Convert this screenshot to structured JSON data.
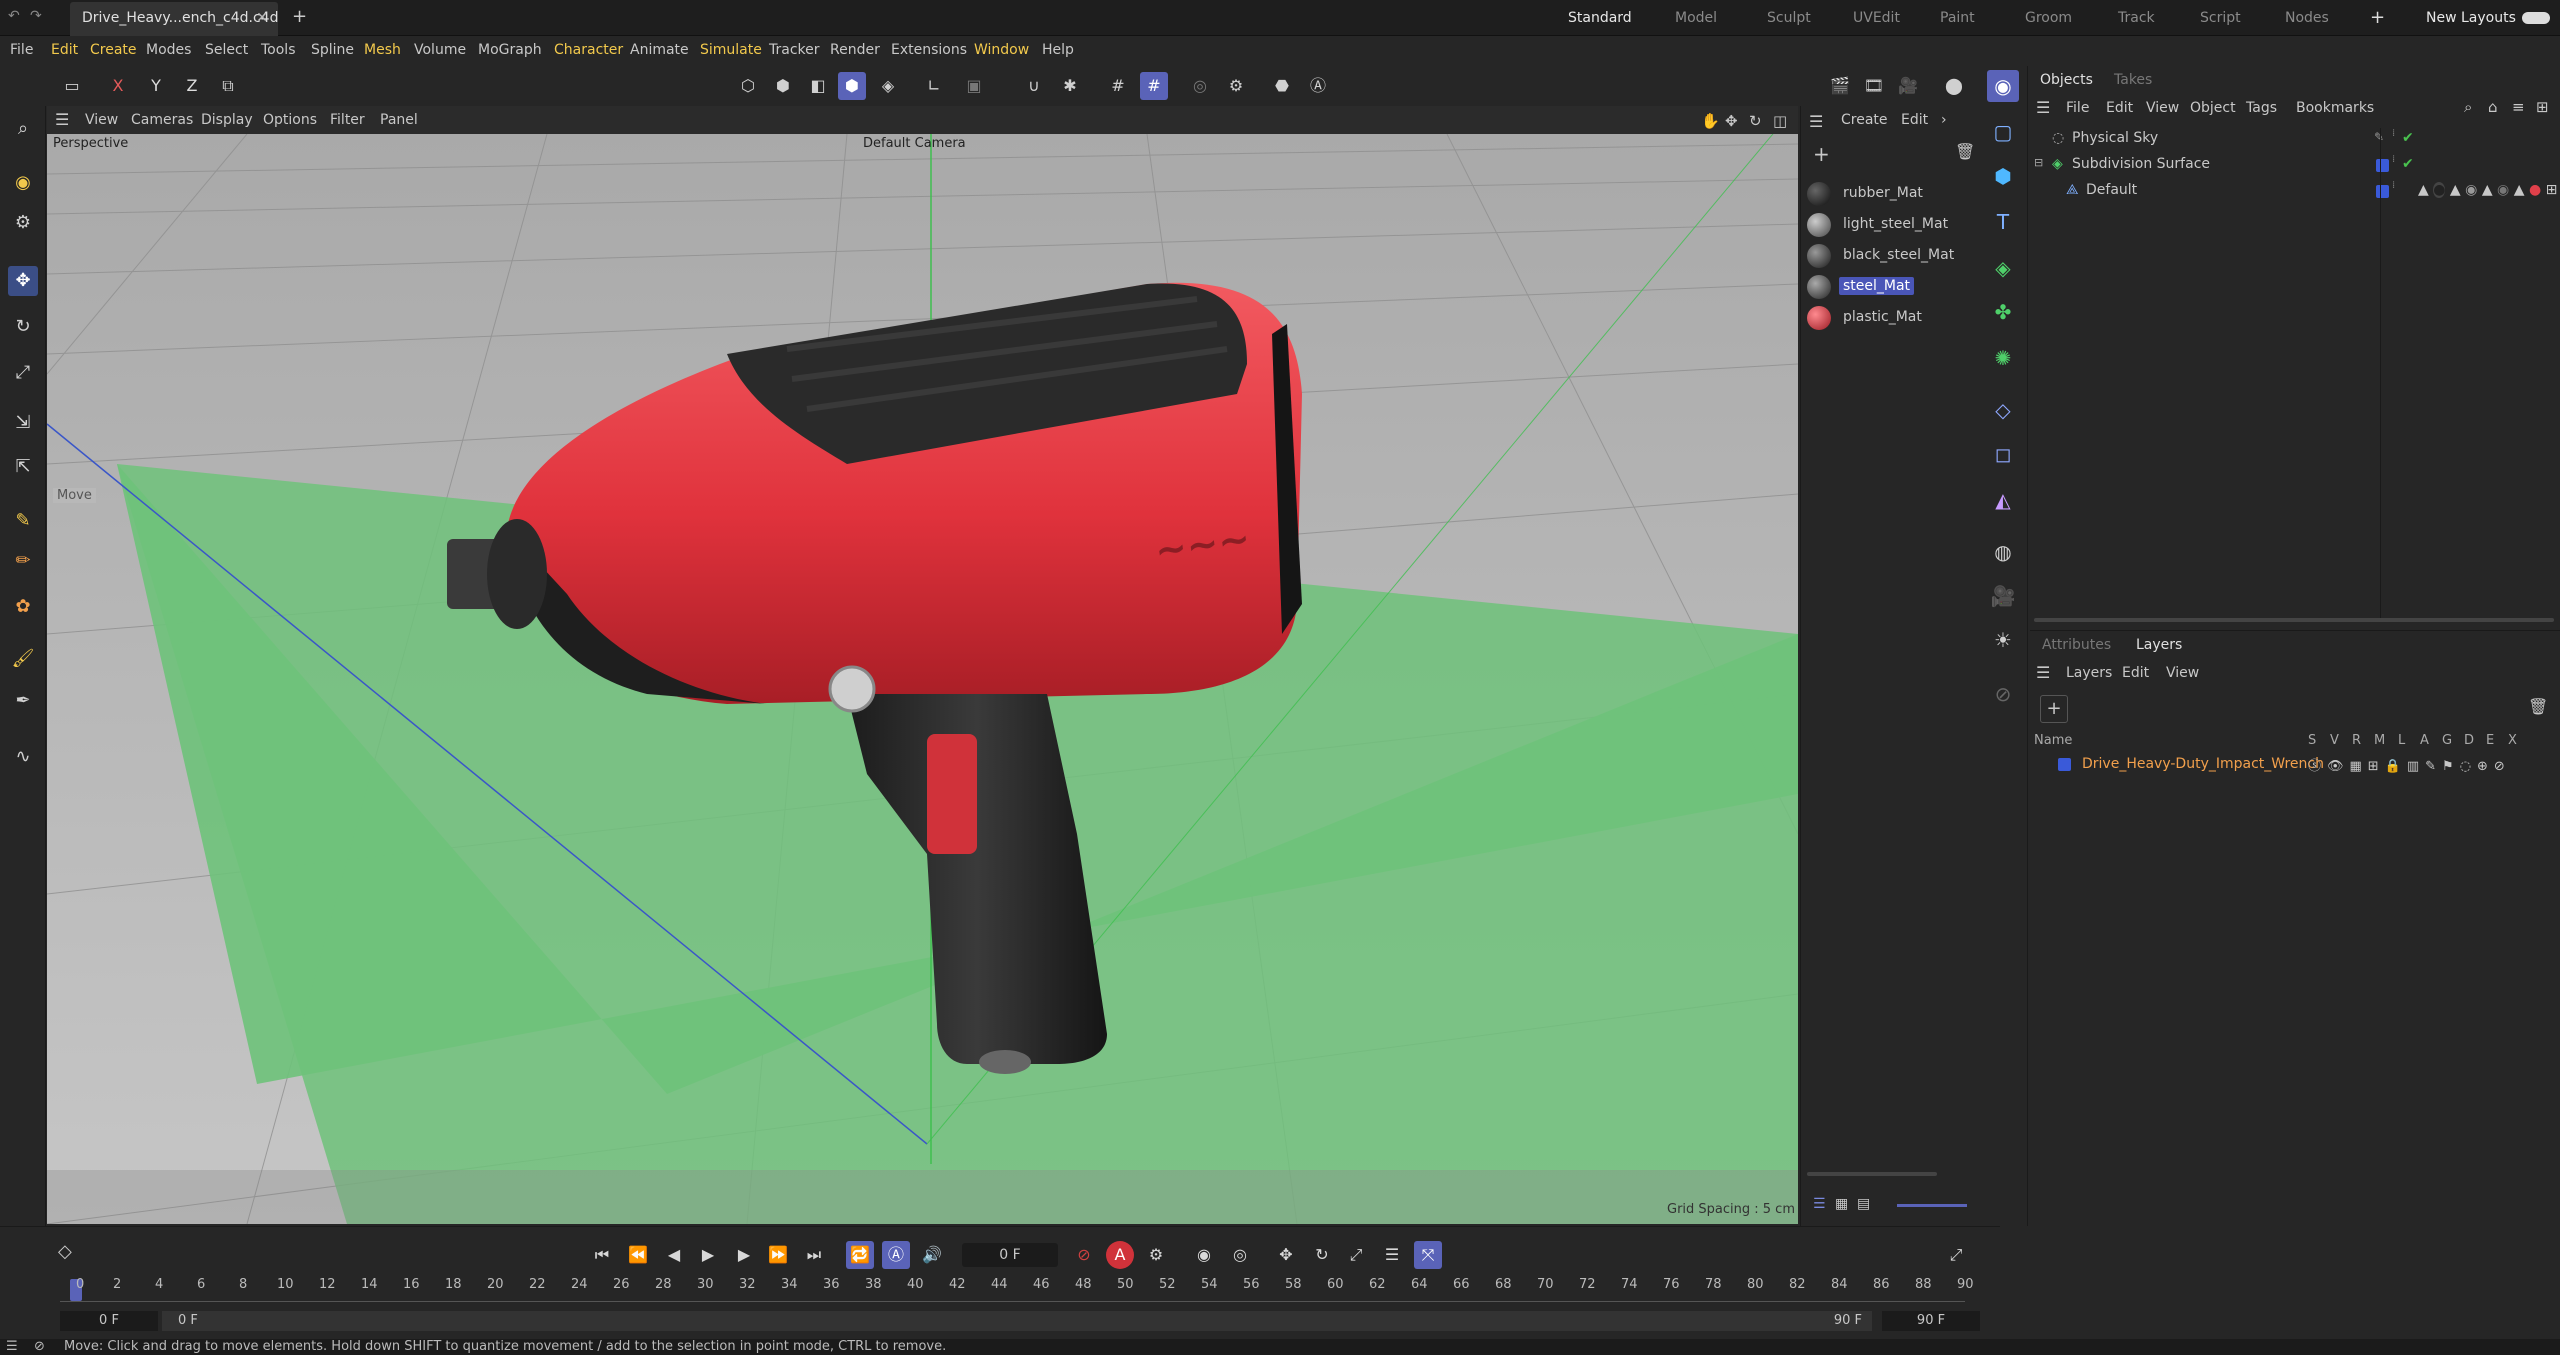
{
  "title_bar": {
    "document_tab": "Drive_Heavy...ench_c4d.c4d",
    "layouts": [
      "Standard",
      "Model",
      "Sculpt",
      "UVEdit",
      "Paint",
      "Groom",
      "Track",
      "Script",
      "Nodes"
    ],
    "new_layouts": "New Layouts"
  },
  "menu": [
    "File",
    "Edit",
    "Create",
    "Modes",
    "Select",
    "Tools",
    "Spline",
    "Mesh",
    "Volume",
    "MoGraph",
    "Character",
    "Animate",
    "Simulate",
    "Tracker",
    "Render",
    "Extensions",
    "Window",
    "Help"
  ],
  "axis_toolbar": {
    "x": "X",
    "y": "Y",
    "z": "Z"
  },
  "viewport": {
    "menu": [
      "View",
      "Cameras",
      "Display",
      "Options",
      "Filter",
      "Panel"
    ],
    "projection": "Perspective",
    "camera": "Default Camera",
    "tool_hint": "Move",
    "grid_spacing": "Grid Spacing : 5 cm"
  },
  "material_manager": {
    "menu": [
      "Create",
      "Edit"
    ],
    "materials": [
      {
        "name": "rubber_Mat",
        "color": "#1a1a1a",
        "selected": false
      },
      {
        "name": "light_steel_Mat",
        "color": "#6a6a6a",
        "selected": false
      },
      {
        "name": "black_steel_Mat",
        "color": "#2e2e2e",
        "selected": false
      },
      {
        "name": "steel_Mat",
        "color": "#3a3a3a",
        "selected": true
      },
      {
        "name": "plastic_Mat",
        "color": "#d0323a",
        "selected": false
      }
    ]
  },
  "objects_panel": {
    "tabs": [
      "Objects",
      "Takes"
    ],
    "menu": [
      "File",
      "Edit",
      "View",
      "Object",
      "Tags",
      "Bookmarks"
    ],
    "items": [
      {
        "name": "Physical Sky",
        "indent": 0
      },
      {
        "name": "Subdivision Surface",
        "indent": 0
      },
      {
        "name": "Default",
        "indent": 1
      }
    ]
  },
  "layers_panel": {
    "tabs": [
      "Attributes",
      "Layers"
    ],
    "menu": [
      "Layers",
      "Edit",
      "View"
    ],
    "columns": [
      "Name",
      "S",
      "V",
      "R",
      "M",
      "L",
      "A",
      "G",
      "D",
      "E",
      "X"
    ],
    "layers": [
      {
        "name": "Drive_Heavy-Duty_Impact_Wrench",
        "color": "#3a5ad9"
      }
    ]
  },
  "timeline": {
    "current_frame": "0 F",
    "ruler_ticks": [
      "0",
      "2",
      "4",
      "6",
      "8",
      "10",
      "12",
      "14",
      "16",
      "18",
      "20",
      "22",
      "24",
      "26",
      "28",
      "30",
      "32",
      "34",
      "36",
      "38",
      "40",
      "42",
      "44",
      "46",
      "48",
      "50",
      "52",
      "54",
      "56",
      "58",
      "60",
      "62",
      "64",
      "66",
      "68",
      "70",
      "72",
      "74",
      "76",
      "78",
      "80",
      "82",
      "84",
      "86",
      "88",
      "90"
    ],
    "range_start": "0 F",
    "range_start2": "0 F",
    "range_end": "90 F",
    "range_end2": "90 F"
  },
  "status": "Move: Click and drag to move elements. Hold down SHIFT to quantize movement / add to the selection in point mode, CTRL to remove.",
  "colors": {
    "accent": "#5a63b8",
    "menu_highlight": "#f2c94c",
    "plastic_red": "#e0404a",
    "grid_green": "#6ec27a"
  }
}
